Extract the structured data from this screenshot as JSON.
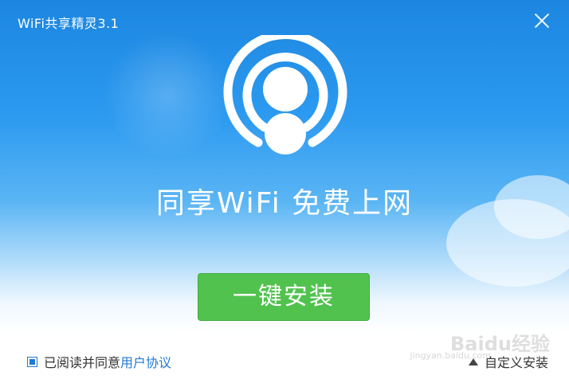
{
  "window": {
    "title": "WiFi共享精灵3.1"
  },
  "main": {
    "slogan": "同享WiFi 免费上网",
    "install_button": "一键安装"
  },
  "footer": {
    "agree_text": "已阅读并同意",
    "agree_link": "用户协议",
    "agree_checked": true,
    "custom_install": "自定义安装"
  },
  "watermark": {
    "text": "Baidu经验",
    "sub": "jingyan.baidu.com"
  },
  "colors": {
    "accent": "#1f7ad6",
    "button": "#52c24f",
    "sky": "#2c9af0"
  },
  "icons": {
    "close": "close-icon",
    "logo": "wifi-logo-icon",
    "expand": "triangle-up-icon"
  }
}
